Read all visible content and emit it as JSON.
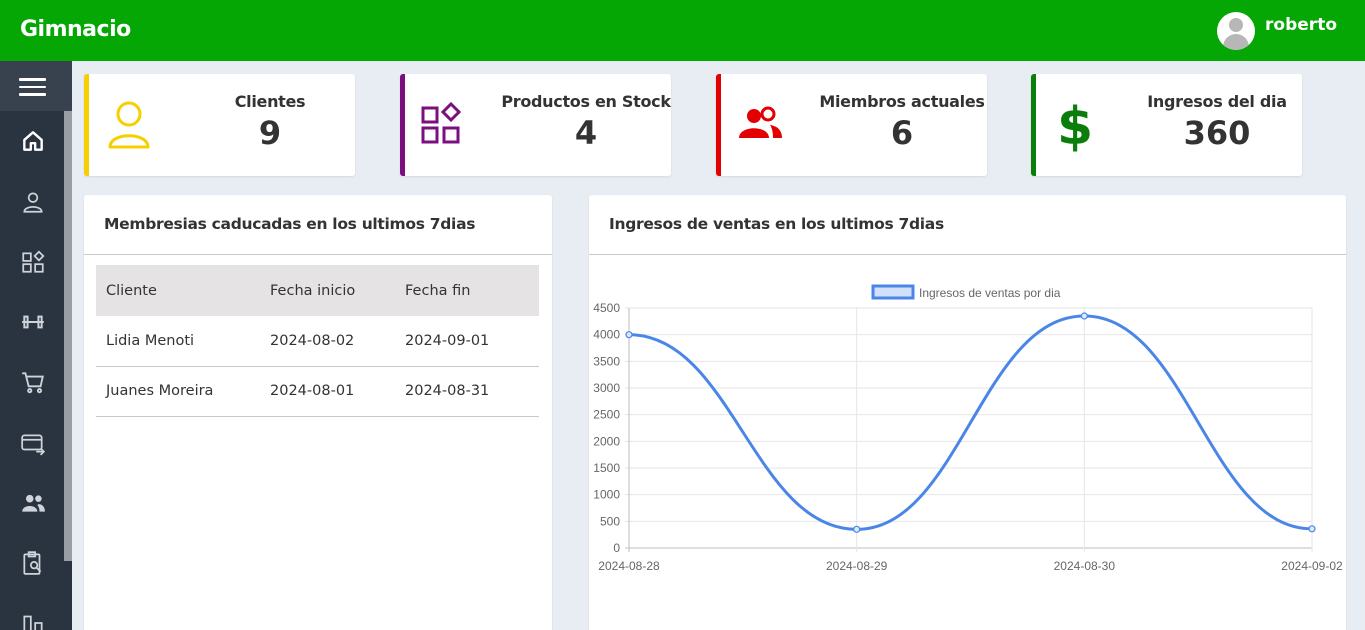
{
  "header": {
    "brand": "Gimnacio",
    "username": "roberto"
  },
  "sidebar": {
    "items": [
      {
        "icon": "home-icon"
      },
      {
        "icon": "user-icon"
      },
      {
        "icon": "products-icon"
      },
      {
        "icon": "dumbbell-icon"
      },
      {
        "icon": "cart-icon"
      },
      {
        "icon": "payment-icon"
      },
      {
        "icon": "members-icon"
      },
      {
        "icon": "report-icon"
      },
      {
        "icon": "chart-icon"
      }
    ]
  },
  "stats": [
    {
      "label": "Clientes",
      "value": "9",
      "color": "#f5d000",
      "icon": "user-icon"
    },
    {
      "label": "Productos en Stock",
      "value": "4",
      "color": "#7b0f7f",
      "icon": "products-icon"
    },
    {
      "label": "Miembros actuales",
      "value": "6",
      "color": "#e30000",
      "icon": "members-icon"
    },
    {
      "label": "Ingresos del dia",
      "value": "360",
      "color": "#0a7d0a",
      "icon": "dollar-icon"
    }
  ],
  "expired": {
    "title": "Membresias caducadas en los ultimos 7dias",
    "columns": [
      "Cliente",
      "Fecha inicio",
      "Fecha fin"
    ],
    "rows": [
      [
        "Lidia Menoti",
        "2024-08-02",
        "2024-09-01"
      ],
      [
        "Juanes Moreira",
        "2024-08-01",
        "2024-08-31"
      ]
    ]
  },
  "sales": {
    "title": "Ingresos de ventas en los ultimos 7dias"
  },
  "chart_data": {
    "type": "line",
    "categories": [
      "2024-08-28",
      "2024-08-29",
      "2024-08-30",
      "2024-09-02"
    ],
    "series": [
      {
        "name": "Ingresos de ventas por dia",
        "values": [
          4000,
          350,
          4350,
          360
        ],
        "color": "#4a86e8"
      }
    ],
    "yticks": [
      0,
      500,
      1000,
      1500,
      2000,
      2500,
      3000,
      3500,
      4000,
      4500
    ],
    "ylim": [
      0,
      4500
    ],
    "legend": "top",
    "grid": true
  }
}
